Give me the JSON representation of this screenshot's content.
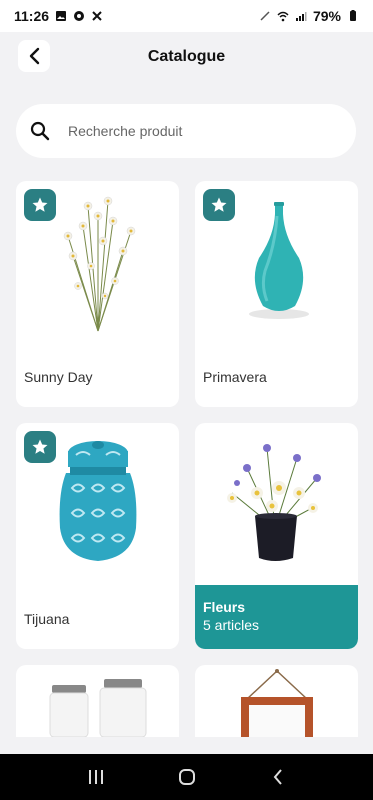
{
  "status_bar": {
    "time": "11:26",
    "battery": "79%"
  },
  "header": {
    "title": "Catalogue"
  },
  "search": {
    "placeholder": "Recherche produit"
  },
  "products": [
    {
      "label": "Sunny Day",
      "favorite": true
    },
    {
      "label": "Primavera",
      "favorite": true
    },
    {
      "label": "Tijuana",
      "favorite": true
    }
  ],
  "category": {
    "name": "Fleurs",
    "count": "5 articles"
  },
  "colors": {
    "accent": "#1e9696",
    "favorite_badge": "#2b7f83",
    "background": "#f2f2f4"
  }
}
